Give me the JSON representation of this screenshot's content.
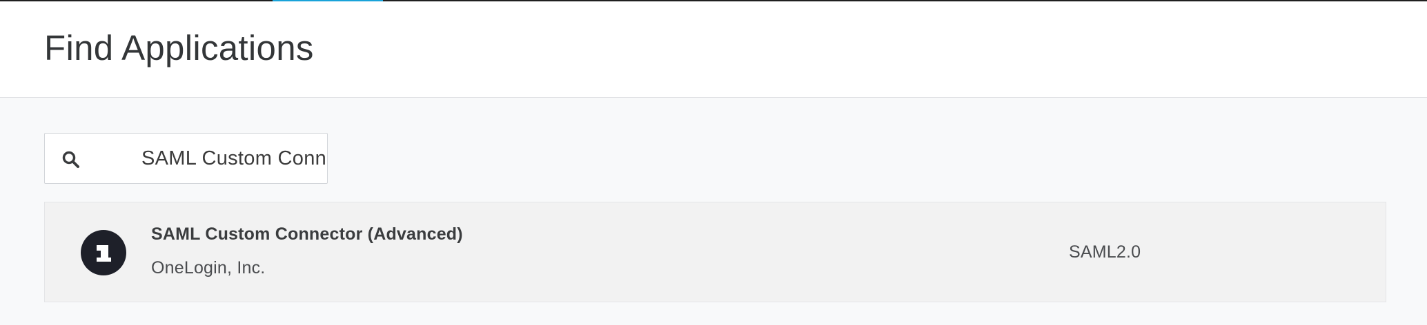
{
  "header": {
    "title": "Find Applications"
  },
  "search": {
    "value": "SAML Custom Connector",
    "icon": "search-icon"
  },
  "results": [
    {
      "logo_icon": "onelogin-logo",
      "logo_text": "1",
      "name": "SAML Custom Connector (Advanced)",
      "vendor": "OneLogin, Inc.",
      "protocol": "SAML2.0"
    }
  ],
  "colors": {
    "accent": "#1aa3d9",
    "logo_bg": "#1e2029",
    "page_bg": "#f8f9fa",
    "row_bg": "#f2f2f2"
  }
}
